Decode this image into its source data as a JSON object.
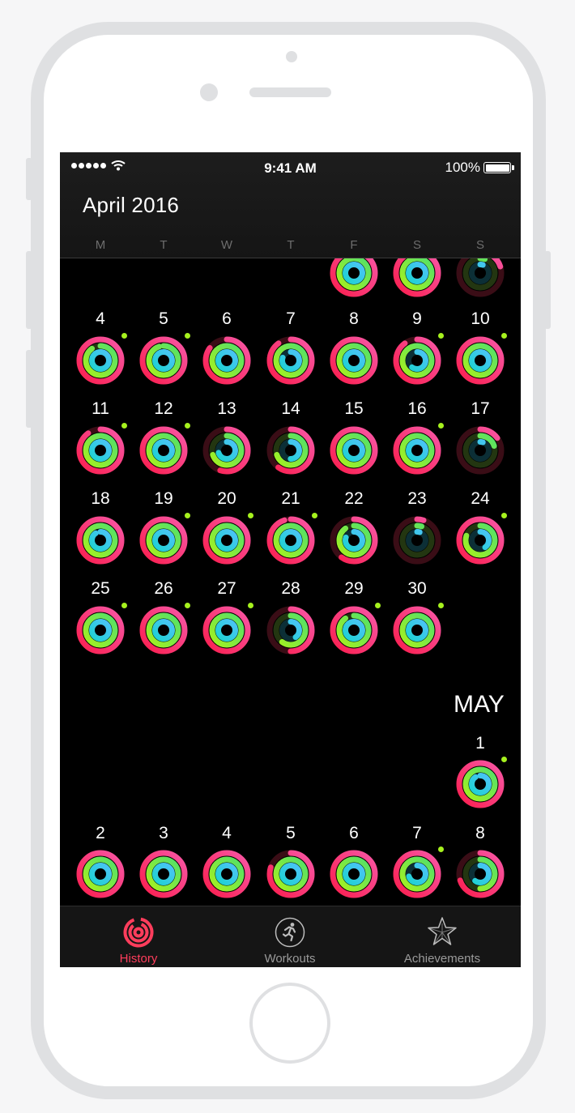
{
  "status_bar": {
    "time": "9:41 AM",
    "battery": "100%"
  },
  "header": {
    "title": "April 2016",
    "weekdays": [
      "M",
      "T",
      "W",
      "T",
      "F",
      "S",
      "S"
    ]
  },
  "sections": [
    {
      "month_label": "",
      "weeks": [
        {
          "days": [
            null,
            null,
            null,
            null,
            {
              "day": "",
              "move": 0.95,
              "exercise": 1.0,
              "stand": 1.0,
              "dot": false
            },
            {
              "day": "",
              "move": 1.0,
              "exercise": 1.0,
              "stand": 1.0,
              "dot": false
            },
            {
              "day": "",
              "move": 0.2,
              "exercise": 0.05,
              "stand": 0.05,
              "dot": false
            }
          ]
        },
        {
          "days": [
            {
              "day": "4",
              "move": 1.0,
              "exercise": 0.9,
              "stand": 1.0,
              "dot": true
            },
            {
              "day": "5",
              "move": 1.0,
              "exercise": 0.95,
              "stand": 1.0,
              "dot": true
            },
            {
              "day": "6",
              "move": 0.85,
              "exercise": 1.0,
              "stand": 1.0,
              "dot": false
            },
            {
              "day": "7",
              "move": 0.9,
              "exercise": 1.0,
              "stand": 0.8,
              "dot": false
            },
            {
              "day": "8",
              "move": 1.0,
              "exercise": 1.0,
              "stand": 1.0,
              "dot": false
            },
            {
              "day": "9",
              "move": 0.9,
              "exercise": 1.0,
              "stand": 0.6,
              "dot": true
            },
            {
              "day": "10",
              "move": 1.0,
              "exercise": 1.0,
              "stand": 1.0,
              "dot": true
            }
          ]
        },
        {
          "days": [
            {
              "day": "11",
              "move": 0.9,
              "exercise": 1.0,
              "stand": 1.0,
              "dot": true
            },
            {
              "day": "12",
              "move": 1.0,
              "exercise": 1.0,
              "stand": 1.0,
              "dot": true
            },
            {
              "day": "13",
              "move": 0.55,
              "exercise": 0.7,
              "stand": 0.7,
              "dot": false
            },
            {
              "day": "14",
              "move": 0.6,
              "exercise": 0.7,
              "stand": 0.5,
              "dot": false
            },
            {
              "day": "15",
              "move": 1.0,
              "exercise": 1.0,
              "stand": 1.0,
              "dot": false
            },
            {
              "day": "16",
              "move": 1.0,
              "exercise": 1.0,
              "stand": 1.0,
              "dot": true
            },
            {
              "day": "17",
              "move": 0.15,
              "exercise": 0.2,
              "stand": 0.05,
              "dot": false
            }
          ]
        },
        {
          "days": [
            {
              "day": "18",
              "move": 1.0,
              "exercise": 1.0,
              "stand": 0.9,
              "dot": false
            },
            {
              "day": "19",
              "move": 1.0,
              "exercise": 1.0,
              "stand": 1.0,
              "dot": true
            },
            {
              "day": "20",
              "move": 1.0,
              "exercise": 1.0,
              "stand": 1.0,
              "dot": true
            },
            {
              "day": "21",
              "move": 0.95,
              "exercise": 1.0,
              "stand": 1.0,
              "dot": true
            },
            {
              "day": "22",
              "move": 0.6,
              "exercise": 0.9,
              "stand": 0.8,
              "dot": false
            },
            {
              "day": "23",
              "move": 0.05,
              "exercise": 0.05,
              "stand": 0.05,
              "dot": false
            },
            {
              "day": "24",
              "move": 1.0,
              "exercise": 0.8,
              "stand": 0.4,
              "dot": true
            }
          ]
        },
        {
          "days": [
            {
              "day": "25",
              "move": 1.0,
              "exercise": 1.0,
              "stand": 1.0,
              "dot": true
            },
            {
              "day": "26",
              "move": 1.0,
              "exercise": 1.0,
              "stand": 1.0,
              "dot": true
            },
            {
              "day": "27",
              "move": 1.0,
              "exercise": 1.0,
              "stand": 1.0,
              "dot": true
            },
            {
              "day": "28",
              "move": 0.5,
              "exercise": 0.6,
              "stand": 0.4,
              "dot": false
            },
            {
              "day": "29",
              "move": 1.0,
              "exercise": 0.9,
              "stand": 1.0,
              "dot": true
            },
            {
              "day": "30",
              "move": 1.0,
              "exercise": 1.0,
              "stand": 1.0,
              "dot": true
            },
            null
          ]
        }
      ]
    },
    {
      "month_label": "MAY",
      "weeks": [
        {
          "days": [
            null,
            null,
            null,
            null,
            null,
            null,
            {
              "day": "1",
              "move": 1.0,
              "exercise": 1.0,
              "stand": 0.9,
              "dot": true
            }
          ]
        },
        {
          "days": [
            {
              "day": "2",
              "move": 1.0,
              "exercise": 1.0,
              "stand": 1.0,
              "dot": false
            },
            {
              "day": "3",
              "move": 1.0,
              "exercise": 1.0,
              "stand": 1.0,
              "dot": false
            },
            {
              "day": "4",
              "move": 1.0,
              "exercise": 1.0,
              "stand": 1.0,
              "dot": false
            },
            {
              "day": "5",
              "move": 0.8,
              "exercise": 1.0,
              "stand": 1.0,
              "dot": false
            },
            {
              "day": "6",
              "move": 1.0,
              "exercise": 1.0,
              "stand": 1.0,
              "dot": false
            },
            {
              "day": "7",
              "move": 1.0,
              "exercise": 1.0,
              "stand": 0.7,
              "dot": true
            },
            {
              "day": "8",
              "move": 0.7,
              "exercise": 0.5,
              "stand": 0.6,
              "dot": false
            }
          ]
        }
      ]
    }
  ],
  "tabs": [
    {
      "label": "History",
      "icon": "activity-rings-icon",
      "active": true
    },
    {
      "label": "Workouts",
      "icon": "running-figure-icon",
      "active": false
    },
    {
      "label": "Achievements",
      "icon": "star-award-icon",
      "active": false
    }
  ],
  "colors": {
    "move": "#fa1e4e",
    "move_end": "#f857a6",
    "exercise": "#a6f11e",
    "exercise_end": "#52e06a",
    "stand": "#1ed2d2",
    "stand_end": "#4cc3f7",
    "accent": "#ff3d5c",
    "tab_inactive": "#9a9a9a"
  }
}
